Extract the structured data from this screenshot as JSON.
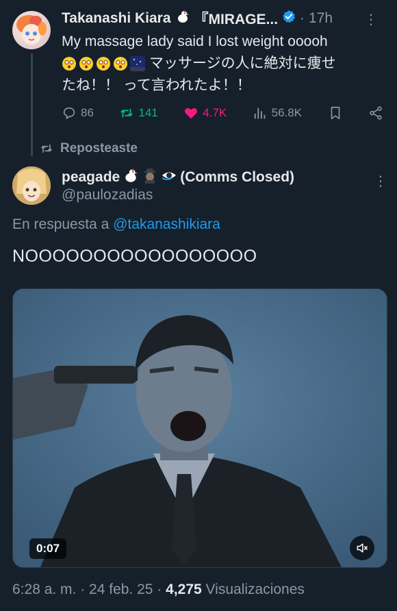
{
  "parent_tweet": {
    "author_name": "Takanashi Kiara",
    "author_suffix": "『MIRAGE...",
    "time": "17h",
    "text_line1": "My massage lady said I lost weight ooooh",
    "text_line2_ja": "マッサージの人に絶対に痩せ",
    "text_line3_ja": "たね！！ って言われたよ！！",
    "emoji_faces": [
      "dizzy-face",
      "dizzy-face",
      "dizzy-face",
      "dizzy-face"
    ],
    "actions": {
      "replies": "86",
      "reposts": "141",
      "likes": "4.7K",
      "views": "56.8K"
    }
  },
  "repost_label": "Reposteaste",
  "reply_tweet": {
    "author_name": "peagade",
    "author_suffix": "(Comms Closed)",
    "handle": "@paulozadias",
    "reply_prefix": "En respuesta a",
    "reply_to": "@takanashikiara",
    "text": "NOOOOOOOOOOOOOOOOO",
    "video_time": "0:07",
    "timestamp": "6:28 a. m. · 24 feb. 25 ·",
    "views_count": "4,275",
    "views_label": "Visualizaciones"
  },
  "colors": {
    "background": "#15202b",
    "text": "#e7e9ea",
    "muted": "#8b98a5",
    "link": "#1d9bf0",
    "repost_green": "#00ba7c",
    "like_pink": "#f91880",
    "verified_blue": "#1d9bf0"
  },
  "icons": [
    "reply-icon",
    "repost-icon",
    "like-icon",
    "views-icon",
    "bookmark-icon",
    "share-icon",
    "verified-icon",
    "more-icon",
    "volume-icon",
    "chicken-icon"
  ]
}
